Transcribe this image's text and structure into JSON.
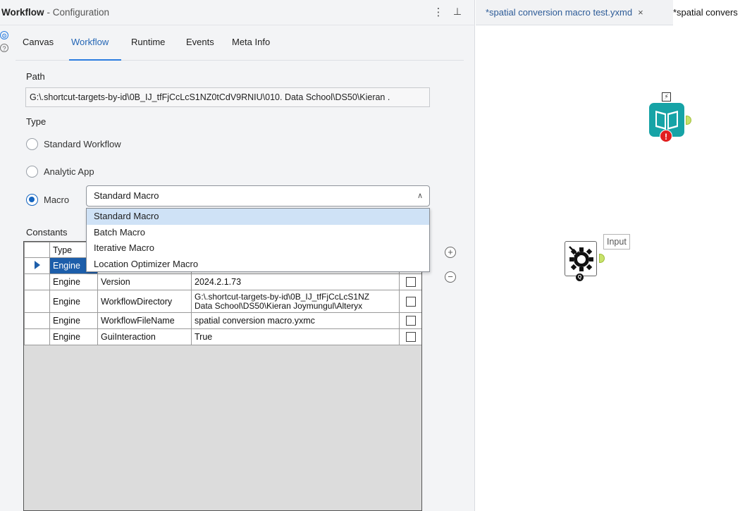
{
  "header": {
    "title": "Workflow",
    "subtitle": "- Configuration",
    "menu_glyph": "⋮",
    "pin_glyph": "⊥"
  },
  "side_icons": {
    "gear": "⚙",
    "help": "?"
  },
  "tabs": [
    {
      "label": "Canvas",
      "active": false
    },
    {
      "label": "Workflow",
      "active": true
    },
    {
      "label": "Runtime",
      "active": false
    },
    {
      "label": "Events",
      "active": false
    },
    {
      "label": "Meta Info",
      "active": false
    }
  ],
  "path": {
    "label": "Path",
    "value": "G:\\.shortcut-targets-by-id\\0B_IJ_tfFjCcLcS1NZ0tCdV9RNIU\\010. Data School\\DS50\\Kieran ."
  },
  "type": {
    "label": "Type",
    "options": [
      "Standard Workflow",
      "Analytic App",
      "Macro"
    ],
    "selected": "Macro"
  },
  "macro_select": {
    "value": "Standard Macro",
    "chevron": "∧",
    "options": [
      "Standard Macro",
      "Batch Macro",
      "Iterative Macro",
      "Location Optimizer Macro"
    ],
    "highlighted": "Standard Macro"
  },
  "constants": {
    "label": "Constants",
    "columns": [
      "Type"
    ],
    "rows": [
      {
        "namespace": "Engine",
        "name": "",
        "value": "",
        "selected": true
      },
      {
        "namespace": "Engine",
        "name": "Version",
        "value": "2024.2.1.73"
      },
      {
        "namespace": "Engine",
        "name": "WorkflowDirectory",
        "value": "G:\\.shortcut-targets-by-id\\0B_IJ_tfFjCcLcS1NZ",
        "value_line2": "Data School\\DS50\\Kieran Joymungul\\Alteryx"
      },
      {
        "namespace": "Engine",
        "name": "WorkflowFileName",
        "value": "spatial conversion macro.yxmc"
      },
      {
        "namespace": "Engine",
        "name": "GuiInteraction",
        "value": "True"
      }
    ],
    "add_glyph": "+",
    "remove_glyph": "−"
  },
  "doc_tabs": [
    {
      "label": "*spatial conversion macro test.yxmd",
      "close": "×"
    },
    {
      "label": "*spatial convers"
    }
  ],
  "canvas_tools": {
    "browse": {
      "bolt": "⚡",
      "error": "!"
    },
    "macro_input": {
      "label": "Input",
      "badge": "Q"
    }
  }
}
